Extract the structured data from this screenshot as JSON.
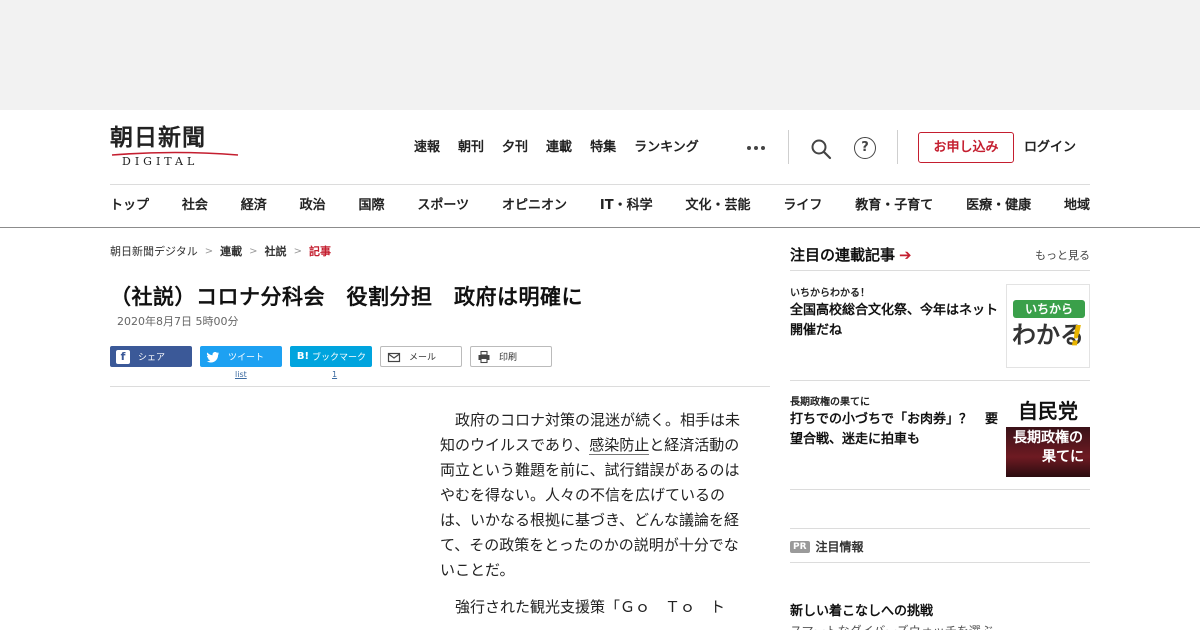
{
  "header": {
    "logo_text": "朝日新聞",
    "logo_sub": "DIGITAL",
    "top_nav": [
      "速報",
      "朝刊",
      "夕刊",
      "連載",
      "特集",
      "ランキング"
    ],
    "apply_label": "お申し込み",
    "login_label": "ログイン",
    "brand_color": "#c41e2f"
  },
  "category_nav": [
    "トップ",
    "社会",
    "経済",
    "政治",
    "国際",
    "スポーツ",
    "オピニオン",
    "IT・科学",
    "文化・芸能",
    "ライフ",
    "教育・子育て",
    "医療・健康",
    "地域"
  ],
  "breadcrumb": [
    "朝日新聞デジタル",
    "連載",
    "社説",
    "記事"
  ],
  "article": {
    "title": "（社説）コロナ分科会　役割分担　政府は明確に",
    "date": "2020年8月7日 5時00分",
    "share": {
      "facebook_label": "シェア",
      "twitter_label": "ツイート",
      "twitter_count": "list",
      "hatena_label": "ブックマーク",
      "hatena_count": "1",
      "mail_label": "メール",
      "print_label": "印刷"
    },
    "p1_before": "政府のコロナ対策の混迷が続く。相手は未知のウイルスであり、",
    "p1_keyword": "感染防止",
    "p1_after": "と経済活動の両立という難題を前に、試行錯誤があるのはやむを得ない。人々の不信を広げているのは、いかなる根拠に基づき、どんな議論を経て、その政策をとったのかの説明が十分でないことだ。",
    "p2": "強行された観光支援策「Ｇｏ　Ｔｏ　ト"
  },
  "sidebar": {
    "heading": "注目の連載記事",
    "more_label": "もっと見る",
    "items": [
      {
        "kicker": "いちからわかる！",
        "headline": "全国高校総合文化祭、今年はネット開催だね",
        "thumb_line1": "いちから",
        "thumb_line2": "わかる",
        "thumb_mark": "!"
      },
      {
        "kicker": "長期政権の果てに",
        "headline": "打ちでの小づちで「お肉券」？　要望合戦、迷走に拍車も",
        "thumb_line1": "自民党",
        "thumb_line2": "長期政権の",
        "thumb_line3": "果てに"
      }
    ],
    "pr_badge": "PR",
    "pr_title": "注目情報",
    "promo_title": "新しい着こなしへの挑戦",
    "promo_sub": "スマートなダイバーズウォッチを選ぶ"
  }
}
